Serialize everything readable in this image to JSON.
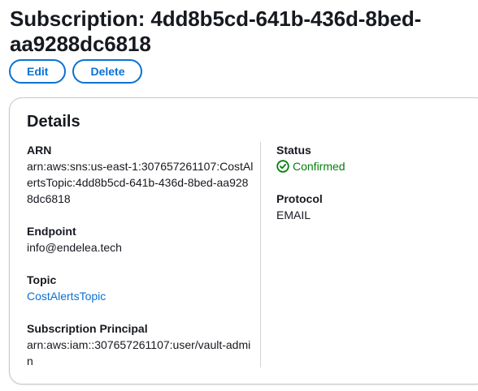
{
  "page": {
    "title": "Subscription: 4dd8b5cd-641b-436d-8bed-aa9288dc6818"
  },
  "actions": {
    "edit_label": "Edit",
    "delete_label": "Delete"
  },
  "details": {
    "heading": "Details",
    "arn": {
      "label": "ARN",
      "value": "arn:aws:sns:us-east-1:307657261107:CostAlertsTopic:4dd8b5cd-641b-436d-8bed-aa9288dc6818"
    },
    "endpoint": {
      "label": "Endpoint",
      "value": "info@endelea.tech"
    },
    "topic": {
      "label": "Topic",
      "value": "CostAlertsTopic"
    },
    "principal": {
      "label": "Subscription Principal",
      "value": "arn:aws:iam::307657261107:user/vault-admin"
    },
    "status": {
      "label": "Status",
      "value": "Confirmed",
      "icon": "check-circle-icon",
      "color": "#037f0c"
    },
    "protocol": {
      "label": "Protocol",
      "value": "EMAIL"
    }
  },
  "colors": {
    "accent": "#0972d3",
    "success": "#037f0c",
    "text": "#16191f",
    "border": "#c6c6cd"
  }
}
